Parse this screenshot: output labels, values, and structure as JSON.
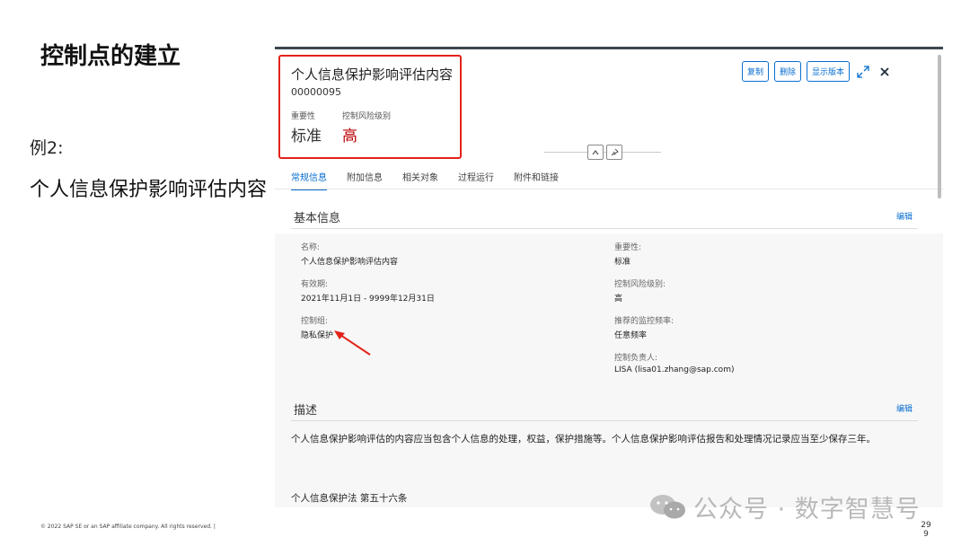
{
  "slide": {
    "title": "控制点的建立",
    "example": "例2:",
    "subtitle": "个人信息保护影响评估内容",
    "copyright": "© 2022 SAP SE or an SAP affiliate company. All rights reserved.  |",
    "page_number_top": "29",
    "page_number_bottom": "9"
  },
  "watermark": {
    "text": "公众号 · 数字智慧号",
    "icon": "wechat-icon"
  },
  "header": {
    "object_title": "个人信息保护影响评估内容",
    "object_id": "00000095",
    "importance_label": "重要性",
    "importance_value": "标准",
    "risk_label": "控制风险级别",
    "risk_value": "高",
    "risk_color": "#bb0000",
    "buttons": {
      "copy": "复制",
      "delete": "删除",
      "show_version": "显示版本"
    },
    "icons": {
      "fullscreen": "expand-icon",
      "close": "close-icon",
      "collapse": "chevron-up-icon",
      "pin": "pin-icon"
    }
  },
  "tabs": [
    "常规信息",
    "附加信息",
    "相关对象",
    "过程运行",
    "附件和链接"
  ],
  "basic_info": {
    "title": "基本信息",
    "edit": "编辑",
    "name_label": "名称:",
    "name_value": "个人信息保护影响评估内容",
    "validity_label": "有效期:",
    "validity_value": "2021年11月1日 - 9999年12月31日",
    "group_label": "控制组:",
    "group_value": "隐私保护",
    "importance_label": "重要性:",
    "importance_value": "标准",
    "risk_label": "控制风险级别:",
    "risk_value": "高",
    "frequency_label": "推荐的监控频率:",
    "frequency_value": "任意频率",
    "owner_label": "控制负责人:",
    "owner_value": "LISA (lisa01.zhang@sap.com)"
  },
  "description": {
    "title": "描述",
    "edit": "编辑",
    "text": "个人信息保护影响评估的内容应当包含个人信息的处理，权益，保护措施等。个人信息保护影响评估报告和处理情况记录应当至少保存三年。",
    "law": "个人信息保护法 第五十六条"
  }
}
